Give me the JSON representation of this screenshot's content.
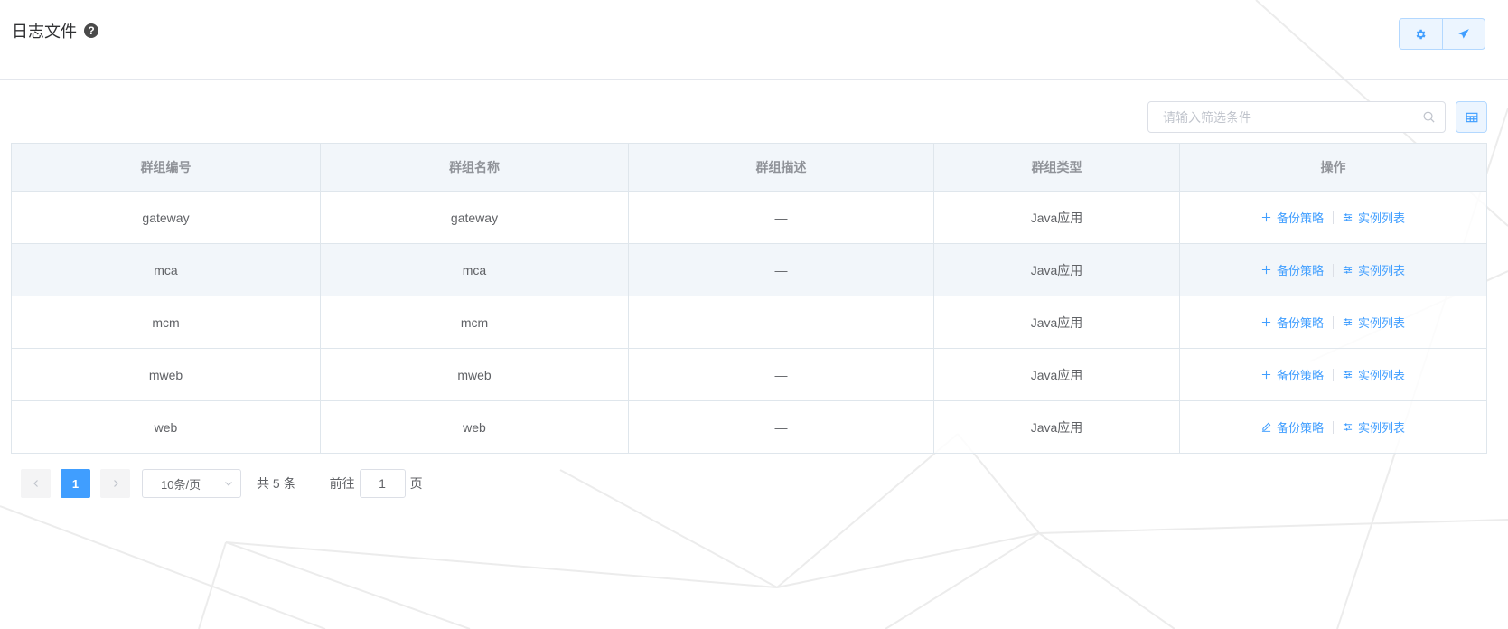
{
  "header": {
    "title": "日志文件",
    "help_icon": "question-circle-icon",
    "actions": [
      {
        "icon": "gear-icon",
        "label": ""
      },
      {
        "icon": "send-icon",
        "label": ""
      }
    ]
  },
  "toolbar": {
    "search_placeholder": "请输入筛选条件",
    "search_value": "",
    "search_icon": "search-icon",
    "columns_icon": "table-columns-icon"
  },
  "table": {
    "columns": [
      "群组编号",
      "群组名称",
      "群组描述",
      "群组类型",
      "操作"
    ],
    "rows": [
      {
        "id": "gateway",
        "name": "gateway",
        "desc": "—",
        "type": "Java应用",
        "op1_icon": "plus-icon",
        "op1": "备份策略",
        "op2_icon": "sliders-icon",
        "op2": "实例列表"
      },
      {
        "id": "mca",
        "name": "mca",
        "desc": "—",
        "type": "Java应用",
        "op1_icon": "plus-icon",
        "op1": "备份策略",
        "op2_icon": "sliders-icon",
        "op2": "实例列表"
      },
      {
        "id": "mcm",
        "name": "mcm",
        "desc": "—",
        "type": "Java应用",
        "op1_icon": "plus-icon",
        "op1": "备份策略",
        "op2_icon": "sliders-icon",
        "op2": "实例列表"
      },
      {
        "id": "mweb",
        "name": "mweb",
        "desc": "—",
        "type": "Java应用",
        "op1_icon": "plus-icon",
        "op1": "备份策略",
        "op2_icon": "sliders-icon",
        "op2": "实例列表"
      },
      {
        "id": "web",
        "name": "web",
        "desc": "—",
        "type": "Java应用",
        "op1_icon": "edit-icon",
        "op1": "备份策略",
        "op2_icon": "sliders-icon",
        "op2": "实例列表"
      }
    ]
  },
  "pagination": {
    "current_page": "1",
    "page_size": "10条/页",
    "total": "共 5 条",
    "goto_prefix": "前往",
    "goto_value": "1",
    "goto_suffix": "页"
  },
  "colors": {
    "accent": "#409eff",
    "header_bg": "#f2f6fa",
    "border": "#dfe6ec",
    "text": "#606266"
  }
}
